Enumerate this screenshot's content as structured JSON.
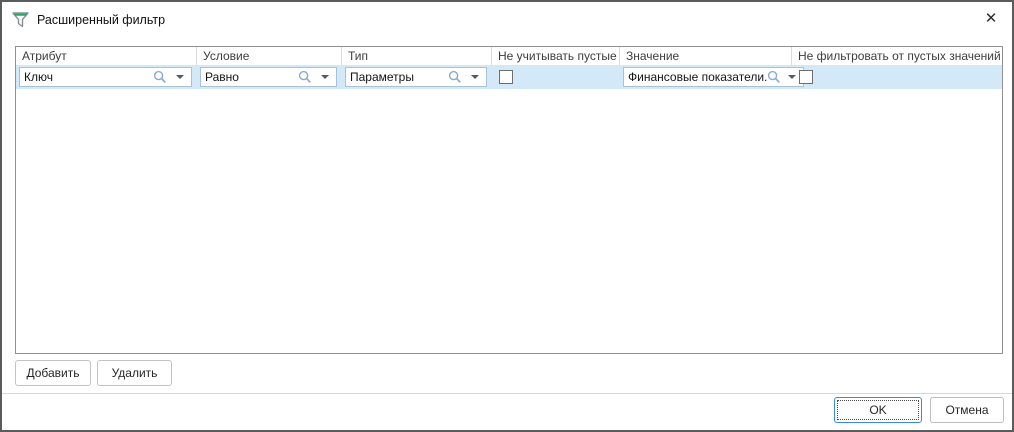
{
  "window": {
    "title": "Расширенный фильтр",
    "close_glyph": "✕"
  },
  "colors": {
    "row_selected_bg": "#d3e9f8",
    "editor_border": "#a9c2d9",
    "search_icon_blue": "#8aaacd",
    "funnel_green": "#27a567",
    "ok_border_blue": "#3c8bd0",
    "grid_border": "#909090"
  },
  "grid": {
    "columns": [
      {
        "label": "Атрибут"
      },
      {
        "label": "Условие"
      },
      {
        "label": "Тип"
      },
      {
        "label": "Не учитывать пустые"
      },
      {
        "label": "Значение"
      },
      {
        "label": "Не фильтровать от пустых значений"
      }
    ],
    "row": {
      "attribute": "Ключ",
      "condition": "Равно",
      "type": "Параметры",
      "ignore_empty_checked": false,
      "value": "Финансовые показатели.",
      "no_filter_empty_checked": false
    }
  },
  "buttons": {
    "add": "Добавить",
    "delete": "Удалить",
    "ok": "OK",
    "cancel": "Отмена"
  }
}
